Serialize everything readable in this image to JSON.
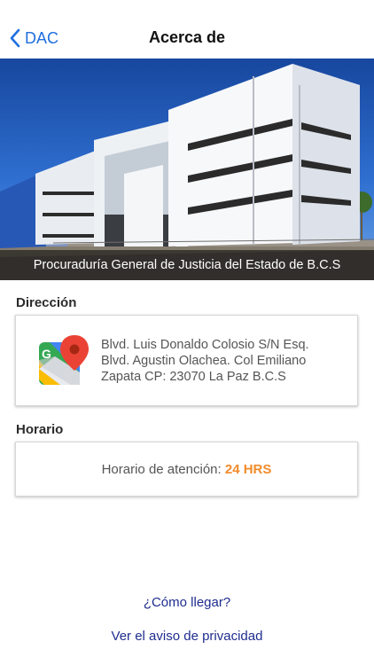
{
  "nav": {
    "back_label": "DAC",
    "title": "Acerca de",
    "back_icon": "chevron-left-icon"
  },
  "hero": {
    "caption": "Procuraduría General de Justicia del Estado de B.C.S"
  },
  "address": {
    "label": "Dirección",
    "line1": "Blvd. Luis Donaldo Colosio S/N Esq.",
    "line2": "Blvd. Agustin Olachea. Col Emiliano",
    "line3": "Zapata CP: 23070 La Paz B.C.S",
    "icon": "google-maps-icon"
  },
  "hours": {
    "label": "Horario",
    "prefix": "Horario de atención:",
    "value": "24 HRS"
  },
  "links": {
    "directions": "¿Cómo llegar?",
    "privacy": "Ver el aviso de privacidad"
  },
  "colors": {
    "accent": "#1f6fe0",
    "link": "#1f2d8f",
    "highlight": "#f28b2a"
  }
}
